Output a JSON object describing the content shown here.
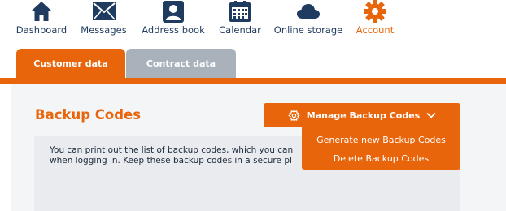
{
  "nav": {
    "items": [
      {
        "label": "Dashboard",
        "icon": "home-icon"
      },
      {
        "label": "Messages",
        "icon": "envelope-icon"
      },
      {
        "label": "Address book",
        "icon": "contact-card-icon"
      },
      {
        "label": "Calendar",
        "icon": "calendar-icon"
      },
      {
        "label": "Online storage",
        "icon": "cloud-icon"
      },
      {
        "label": "Account",
        "icon": "gear-icon",
        "active": true
      }
    ]
  },
  "tabs": [
    {
      "label": "Customer data",
      "active": true
    },
    {
      "label": "Contract data",
      "active": false
    }
  ],
  "page": {
    "title": "Backup Codes",
    "info_lines": [
      "You can print out the list of backup codes, which you can",
      "when logging in. Keep these backup codes in a secure pl"
    ]
  },
  "manage_menu": {
    "button_label": "Manage Backup Codes",
    "items": [
      "Generate new Backup Codes",
      "Delete Backup Codes"
    ]
  },
  "colors": {
    "accent": "#e8650b",
    "nav_text": "#1f3b5f",
    "tab_inactive": "#a9b1bb",
    "content_bg": "#f4f5f7"
  }
}
